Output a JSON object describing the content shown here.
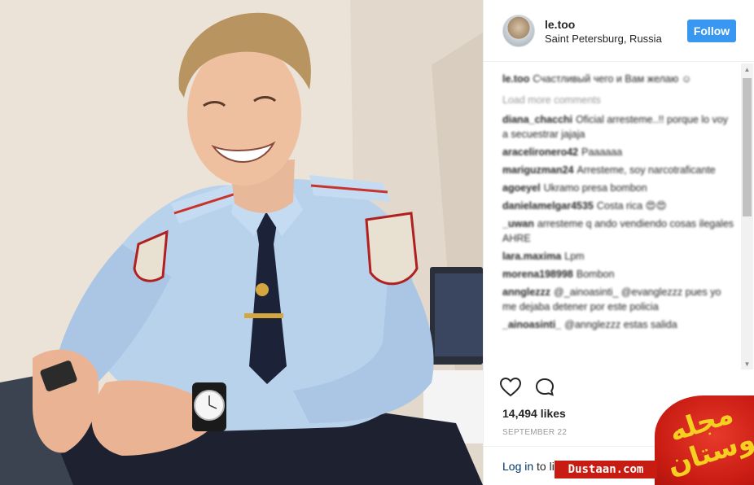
{
  "post": {
    "username": "le.too",
    "location": "Saint Petersburg, Russia",
    "follow_label": "Follow"
  },
  "comments": {
    "caption": {
      "user": "le.too",
      "text": "Счастливый чего и Вам желаю ☺"
    },
    "load_more": "Load more comments",
    "items": [
      {
        "user": "diana_chacchi",
        "text": "Oficial arresteme..!! porque lo voy a secuestrar jajaja"
      },
      {
        "user": "aracelironero42",
        "text": "Paaaaaa"
      },
      {
        "user": "mariguzman24",
        "text": "Arresteme, soy narcotraficante"
      },
      {
        "user": "agoeyel",
        "text": "Ukramo presa bombon"
      },
      {
        "user": "danielamelgar4535",
        "text": "Costa rica 😍😍"
      },
      {
        "user": "_uwan",
        "text": "arresteme q ando vendiendo cosas ilegales AHRE"
      },
      {
        "user": "lara.maxima",
        "text": "Lpm"
      },
      {
        "user": "morena198998",
        "text": "Bombon"
      },
      {
        "user": "annglezzz",
        "text": "@_ainoasinti_ @evanglezzz pues yo me dejaba detener por este policia"
      },
      {
        "user": "_ainoasinti_",
        "text": "@annglezzz estas salida"
      }
    ]
  },
  "actions": {
    "like_icon": "heart-outline-icon",
    "comment_icon": "speech-bubble-icon"
  },
  "likes_text": "14,494 likes",
  "date": "SEPTEMBER 22",
  "login": {
    "link": "Log in",
    "rest": "to li"
  },
  "watermark": {
    "script": "مجله دوستان",
    "site": "Dustaan.com",
    "color": "#c81b12",
    "accent": "#f5d020"
  },
  "colors": {
    "follow_button": "#3897f0",
    "uniform": "#b9d2ec",
    "tie": "#1c2238"
  }
}
